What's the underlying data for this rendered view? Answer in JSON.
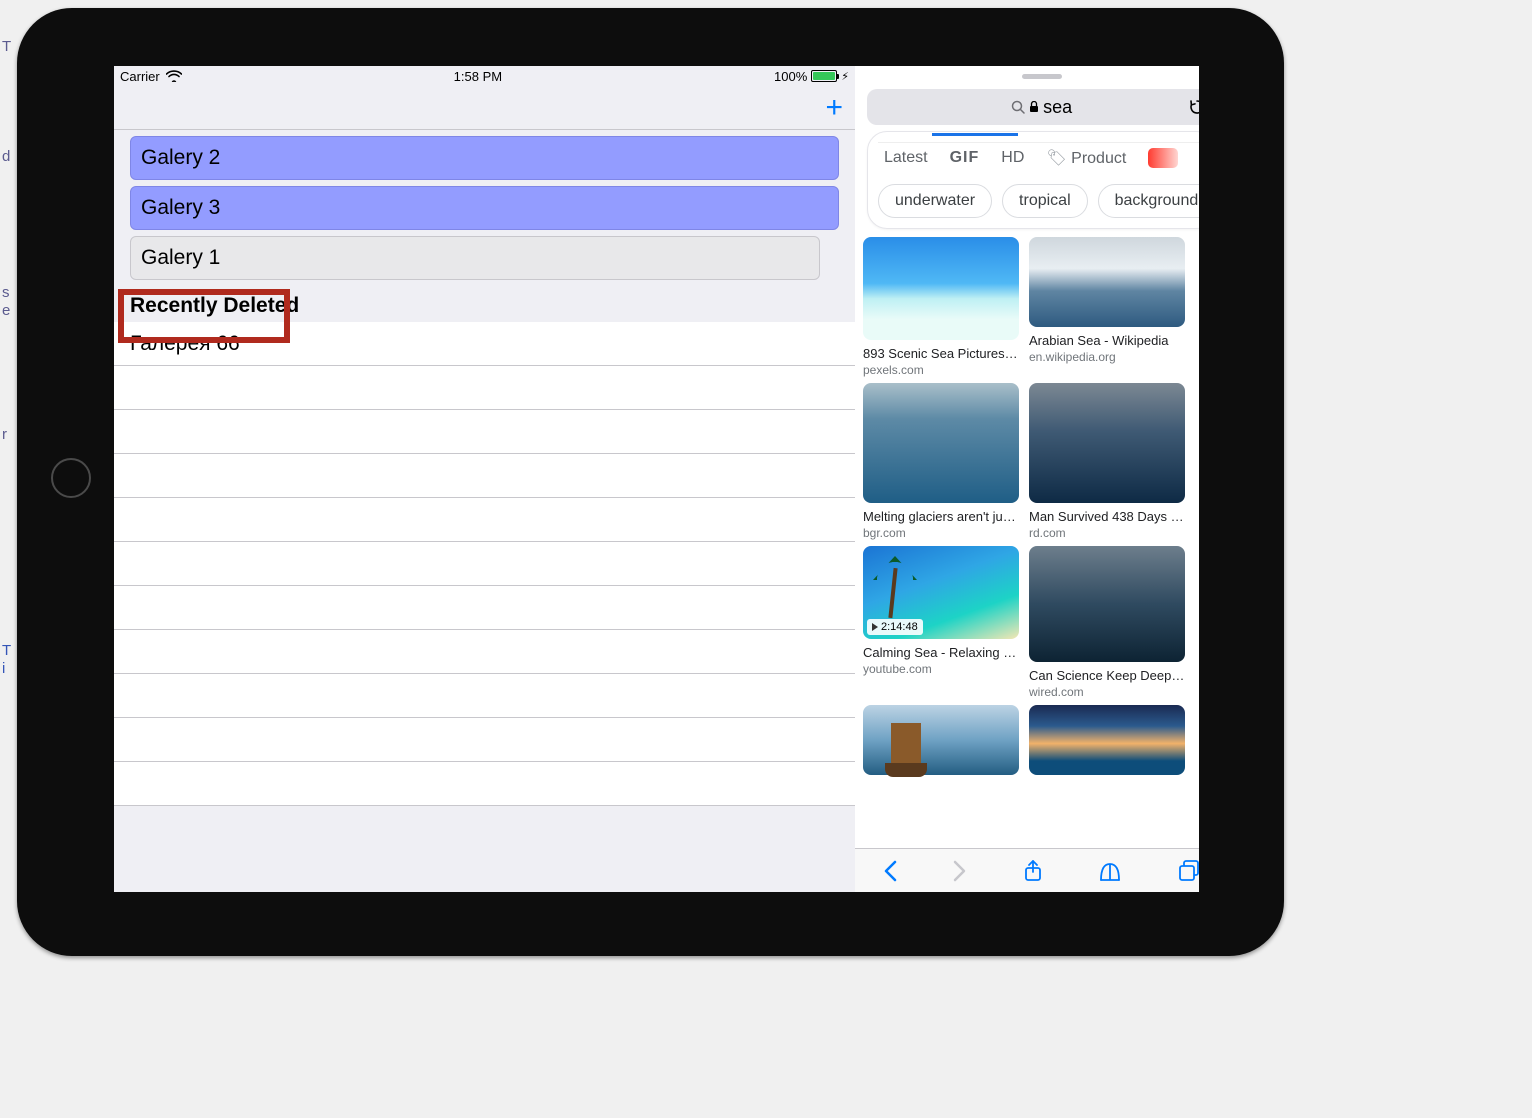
{
  "status": {
    "carrier": "Carrier",
    "time": "1:58 PM",
    "battery_pct": "100%"
  },
  "nav": {
    "add_label": "+"
  },
  "list": {
    "selected": [
      "Galery 2",
      "Galery 3"
    ],
    "dragging": "Galery 1",
    "section_header": "Recently Deleted",
    "deleted": [
      "Галерея 66"
    ]
  },
  "safari": {
    "query": "sea",
    "filters": {
      "latest": "Latest",
      "gif": "GIF",
      "hd": "HD",
      "product": "Product"
    },
    "chips": [
      "underwater",
      "tropical",
      "background"
    ],
    "results": [
      {
        "title": "893 Scenic Sea Pictures · P…",
        "source": "pexels.com",
        "thumb_h": 103,
        "cls": "sea-beach"
      },
      {
        "title": "Arabian Sea - Wikipedia",
        "source": "en.wikipedia.org",
        "thumb_h": 90,
        "cls": "sea-sparkle"
      },
      {
        "title": "Melting glaciers aren't just …",
        "source": "bgr.com",
        "thumb_h": 120,
        "cls": "sea-deep"
      },
      {
        "title": "Man Survived 438 Days Stu…",
        "source": "rd.com",
        "thumb_h": 120,
        "cls": "sea-storm"
      },
      {
        "title": "Calming Sea - Relaxing 2 H…",
        "source": "youtube.com",
        "thumb_h": 93,
        "cls": "sea-palm",
        "video": "2:14:48"
      },
      {
        "title": "Can Science Keep Deep Se…",
        "source": "wired.com",
        "thumb_h": 116,
        "cls": "sea-dark"
      },
      {
        "title": "",
        "source": "",
        "thumb_h": 70,
        "cls": "sea-ship"
      },
      {
        "title": "",
        "source": "",
        "thumb_h": 70,
        "cls": "sea-sunset"
      }
    ]
  }
}
